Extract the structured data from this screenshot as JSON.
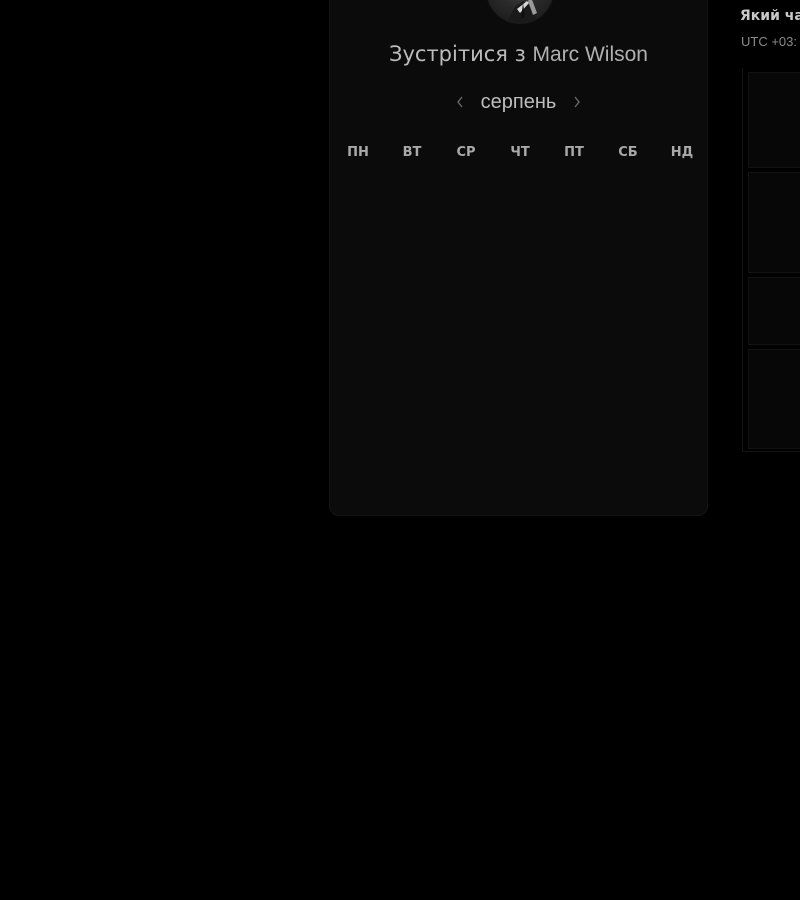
{
  "booking": {
    "title_prefix": "Зустрітися з",
    "host_name": "Marc Wilson",
    "month": "серпень",
    "weekdays": [
      "ПН",
      "ВТ",
      "СР",
      "ЧТ",
      "ПТ",
      "СБ",
      "НД"
    ]
  },
  "timezone_panel": {
    "heading": "Який час",
    "timezone": "UTC +03:"
  },
  "colors": {
    "background": "#000000",
    "card": "#0b0b0b",
    "text_primary": "#bcbcbc",
    "text_muted": "#8a8a8a"
  }
}
